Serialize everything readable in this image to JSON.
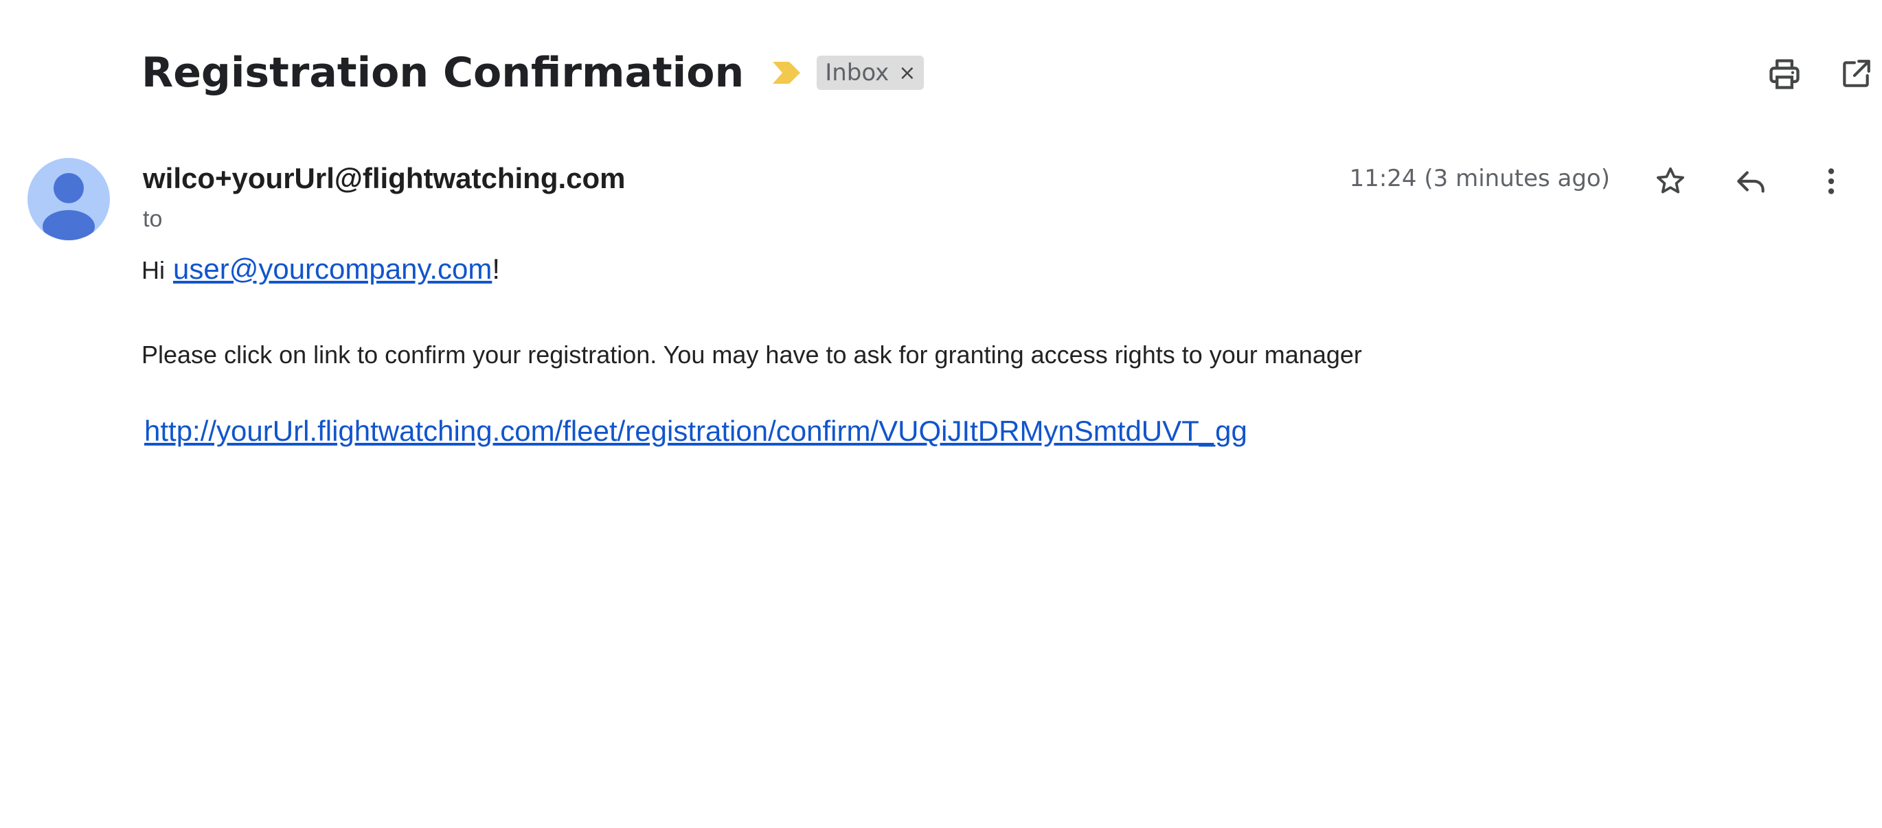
{
  "email": {
    "subject": "Registration Confirmation",
    "label": {
      "name": "Inbox",
      "close_glyph": "×"
    },
    "importance_color": "#f2c94c",
    "sender": "wilco+yourUrl@flightwatching.com",
    "to_label": "to",
    "timestamp": "11:24 (3 minutes ago)",
    "body": {
      "greeting_prefix": "Hi",
      "greeting_email": "user@yourcompany.com",
      "greeting_suffix": "!",
      "instruction": "Please click on link to confirm your registration. You may have to ask for granting access rights to your manager",
      "confirm_link": "http://yourUrl.flightwatching.com/fleet/registration/confirm/VUQiJItDRMynSmtdUVT_gg"
    }
  },
  "icons": {
    "print": "print-icon",
    "open_new_window": "open-in-new-window-icon",
    "star": "star-icon",
    "reply": "reply-icon",
    "more": "more-vertical-icon",
    "avatar": "avatar-person-icon",
    "importance": "importance-marker-icon"
  },
  "colors": {
    "link": "#1155cc",
    "avatar_bg": "#aecbfa",
    "avatar_fg": "#4a73d6",
    "chip_bg": "#dddddd"
  }
}
